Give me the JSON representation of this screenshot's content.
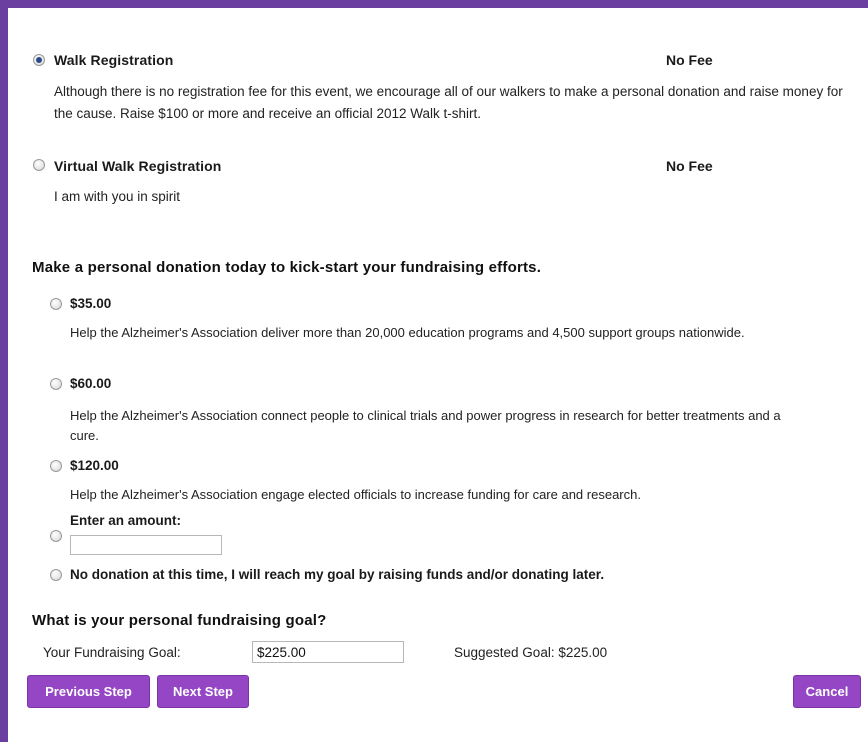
{
  "registration": {
    "options": [
      {
        "title": "Walk Registration",
        "fee": "No Fee",
        "selected": true,
        "description": "Although there is no registration fee for this event, we encourage all of our walkers to make a personal donation and raise money for the cause. Raise $100 or more and receive an official 2012 Walk t-shirt."
      },
      {
        "title": "Virtual Walk Registration",
        "fee": "No Fee",
        "selected": false,
        "description": "I am with you in spirit"
      }
    ]
  },
  "donation": {
    "heading": "Make a personal donation today to kick-start your fundraising efforts.",
    "options": [
      {
        "amount": "$35.00",
        "description": "Help the Alzheimer's Association deliver more than 20,000 education programs and 4,500 support groups nationwide."
      },
      {
        "amount": "$60.00",
        "description": "Help the Alzheimer's Association connect people to clinical trials and power progress in research for better treatments and a cure."
      },
      {
        "amount": "$120.00",
        "description": "Help the Alzheimer's Association engage elected officials to increase funding for care and research."
      }
    ],
    "custom_label": "Enter an amount:",
    "custom_value": "",
    "none_label": "No donation at this time, I will reach my goal by raising funds and/or donating later."
  },
  "goal": {
    "heading": "What is your personal fundraising goal?",
    "label": "Your Fundraising Goal:",
    "value": "$225.00",
    "suggested": "Suggested Goal: $225.00"
  },
  "buttons": {
    "previous": "Previous Step",
    "next": "Next Step",
    "cancel": "Cancel"
  },
  "colors": {
    "frame": "#6b3fa0",
    "button": "#9446c4"
  }
}
